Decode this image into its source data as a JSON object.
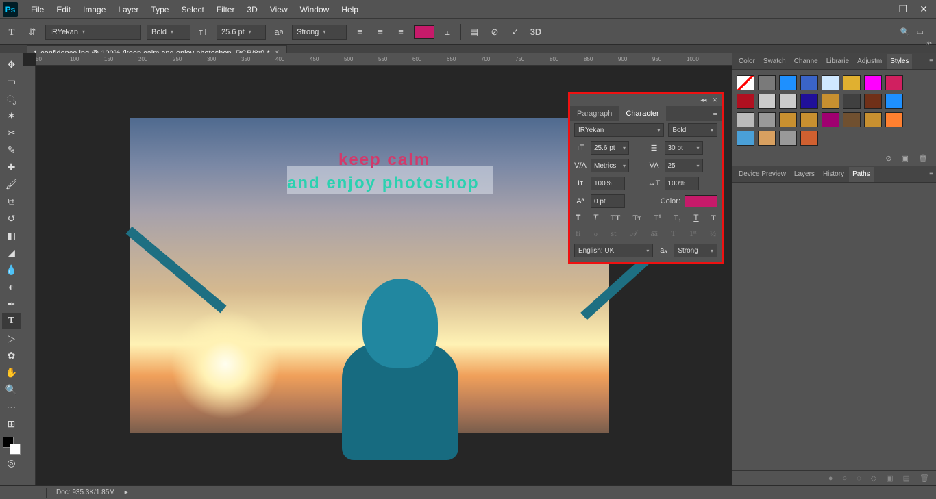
{
  "menu": [
    "File",
    "Edit",
    "Image",
    "Layer",
    "Type",
    "Select",
    "Filter",
    "3D",
    "View",
    "Window",
    "Help"
  ],
  "options": {
    "font": "IRYekan",
    "weight": "Bold",
    "size": "25.6 pt",
    "aa": "Strong",
    "color": "#c61a6a"
  },
  "doc_tab": "t_confidence.jpg @ 100% (keep calm and enjoy photoshop, RGB/8#) *",
  "ruler_ticks": [
    "50",
    "100",
    "150",
    "200",
    "250",
    "300",
    "350",
    "400",
    "450",
    "500",
    "550",
    "600",
    "650",
    "700",
    "750",
    "800",
    "850",
    "900",
    "950",
    "1000"
  ],
  "canvas_text1": "keep calm",
  "canvas_text2": "and enjoy photoshop",
  "right_tabs1": [
    "Color",
    "Swatch",
    "Channe",
    "Librarie",
    "Adjustm",
    "Styles"
  ],
  "right_tabs2": [
    "Device Preview",
    "Layers",
    "History",
    "Paths"
  ],
  "char": {
    "tab_paragraph": "Paragraph",
    "tab_character": "Character",
    "font": "IRYekan",
    "weight": "Bold",
    "size": "25.6 pt",
    "leading": "30 pt",
    "kerning": "Metrics",
    "tracking": "25",
    "vscale": "100%",
    "hscale": "100%",
    "baseline": "0 pt",
    "color_label": "Color:",
    "lang": "English: UK",
    "aa": "Strong"
  },
  "status": {
    "zoom": "",
    "doc": "Doc: 935.3K/1.85M"
  },
  "style_colors": [
    "#ffffff",
    "#7a7a7a",
    "#1e90ff",
    "#3a64c8",
    "#cfe8ff",
    "#e0b030",
    "#ff00ff",
    "#d02060",
    "#b01020",
    "#ccc",
    "#ccc",
    "#20109a",
    "#c89030",
    "#404040",
    "#703018",
    "#1e90ff",
    "#bbb",
    "#999",
    "#c89030",
    "#c89030",
    "#a00070",
    "#705030",
    "#c89030",
    "#ff8030",
    "#4aa0d8",
    "#d8a060",
    "#999",
    "#d06030"
  ]
}
